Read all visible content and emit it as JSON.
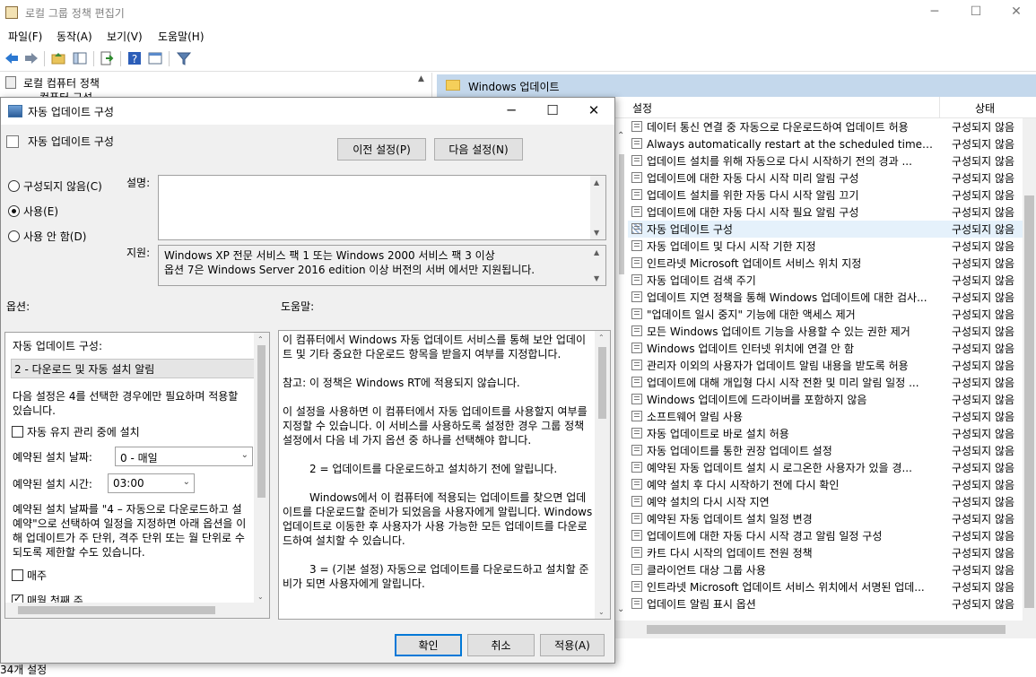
{
  "main_window": {
    "title": "로컬 그룹 정책 편집기",
    "menu": [
      "파일(F)",
      "동작(A)",
      "보기(V)",
      "도움말(H)"
    ],
    "tree_root": "로컬 컴퓨터 정책",
    "tree_child": "컴퓨터 구성",
    "right_header": "Windows 업데이트",
    "col_setting": "설정",
    "col_state": "상태",
    "status_bar": "34개 설정"
  },
  "policies": [
    {
      "name": "데이터 통신 연결 중 자동으로 다운로드하여 업데이트 허용",
      "state": "구성되지 않음"
    },
    {
      "name": "Always automatically restart at the scheduled time(항상 예...",
      "state": "구성되지 않음"
    },
    {
      "name": "업데이트 설치를 위해 자동으로 다시 시작하기 전의 경과 ...",
      "state": "구성되지 않음"
    },
    {
      "name": "업데이트에 대한 자동 다시 시작 미리 알림 구성",
      "state": "구성되지 않음"
    },
    {
      "name": "업데이트 설치를 위한 자동 다시 시작 알림 끄기",
      "state": "구성되지 않음"
    },
    {
      "name": "업데이트에 대한 자동 다시 시작 필요 알림 구성",
      "state": "구성되지 않음"
    },
    {
      "name": "자동 업데이트 구성",
      "state": "구성되지 않음"
    },
    {
      "name": "자동 업데이트 및 다시 시작 기한 지정",
      "state": "구성되지 않음"
    },
    {
      "name": "인트라넷 Microsoft 업데이트 서비스 위치 지정",
      "state": "구성되지 않음"
    },
    {
      "name": "자동 업데이트 검색 주기",
      "state": "구성되지 않음"
    },
    {
      "name": "업데이트 지연 정책을 통해 Windows 업데이트에 대한 검사...",
      "state": "구성되지 않음"
    },
    {
      "name": "\"업데이트 일시 중지\" 기능에 대한 액세스 제거",
      "state": "구성되지 않음"
    },
    {
      "name": "모든 Windows 업데이트 기능을 사용할 수 있는 권한 제거",
      "state": "구성되지 않음"
    },
    {
      "name": "Windows 업데이트 인터넷 위치에 연결 안 함",
      "state": "구성되지 않음"
    },
    {
      "name": "관리자 이외의 사용자가 업데이트 알림 내용을 받도록 허용",
      "state": "구성되지 않음"
    },
    {
      "name": "업데이트에 대해 개입형 다시 시작 전환 및 미리 알림 일정 ...",
      "state": "구성되지 않음"
    },
    {
      "name": "Windows 업데이트에 드라이버를 포함하지 않음",
      "state": "구성되지 않음"
    },
    {
      "name": "소프트웨어 알림 사용",
      "state": "구성되지 않음"
    },
    {
      "name": "자동 업데이트로 바로 설치 허용",
      "state": "구성되지 않음"
    },
    {
      "name": "자동 업데이트를 통한 권장 업데이트 설정",
      "state": "구성되지 않음"
    },
    {
      "name": "예약된 자동 업데이트 설치 시 로그온한 사용자가 있을 경...",
      "state": "구성되지 않음"
    },
    {
      "name": "예약 설치 후 다시 시작하기 전에 다시 확인",
      "state": "구성되지 않음"
    },
    {
      "name": "예약 설치의 다시 시작 지연",
      "state": "구성되지 않음"
    },
    {
      "name": "예약된 자동 업데이트 설치 일정 변경",
      "state": "구성되지 않음"
    },
    {
      "name": "업데이트에 대한 자동 다시 시작 경고 알림 일정 구성",
      "state": "구성되지 않음"
    },
    {
      "name": "카트 다시 시작의 업데이트 전원 정책",
      "state": "구성되지 않음"
    },
    {
      "name": "클라이언트 대상 그룹 사용",
      "state": "구성되지 않음"
    },
    {
      "name": "인트라넷 Microsoft 업데이트 서비스 위치에서 서명된 업데...",
      "state": "구성되지 않음"
    },
    {
      "name": "업데이트 알림 표시 옵션",
      "state": "구성되지 않음"
    }
  ],
  "dialog": {
    "title": "자동 업데이트 구성",
    "heading": "자동 업데이트 구성",
    "prev_button": "이전 설정(P)",
    "next_button": "다음 설정(N)",
    "radio_not_configured": "구성되지 않음(C)",
    "radio_enabled": "사용(E)",
    "radio_disabled": "사용 안 함(D)",
    "comment_label": "설명:",
    "supported_label": "지원:",
    "supported_line1": "Windows XP 전문 서비스 팩 1 또는 Windows 2000 서비스 팩 3 이상",
    "supported_line2": "옵션 7은 Windows Server 2016 edition 이상 버전의 서버 에서만 지원됩니다.",
    "options_label": "옵션:",
    "help_label": "도움말:",
    "ok_button": "확인",
    "cancel_button": "취소",
    "apply_button": "적용(A)"
  },
  "options": {
    "configure_label": "자동 업데이트 구성:",
    "configure_value": "2 - 다운로드 및 자동 설치 알림",
    "note": "다음 설정은 4를 선택한 경우에만 필요하며 적용할 수 있습니다.",
    "note_line1": "다음 설정은 4를 선택한 경우에만 필요하며 적용할",
    "note_line2": "있습니다.",
    "maintenance_check": "자동 유지 관리 중에 설치",
    "day_label": "예약된 설치 날짜:",
    "day_value": "0 - 매일",
    "time_label": "예약된 설치 시간:",
    "time_value": "03:00",
    "desc_line1": "예약된 설치 날짜를 \"4 – 자동으로 다운로드하고 설",
    "desc_line2": "예약\"으로 선택하여 일정을 지정하면 아래 옵션을 이",
    "desc_line3": "해 업데이트가 주 단위, 격주 단위 또는 월 단위로 수",
    "desc_line4": "되도록 제한할 수도 있습니다.",
    "weekly_check": "매주",
    "first_week_check": "매월 첫째 주"
  },
  "help": {
    "p1": "이 컴퓨터에서 Windows 자동 업데이트 서비스를 통해 보안 업데이트 및 기타 중요한 다운로드 항목을 받을지 여부를 지정합니다.",
    "p2": "참고: 이 정책은 Windows RT에 적용되지 않습니다.",
    "p3": "이 설정을 사용하면 이 컴퓨터에서 자동 업데이트를 사용할지 여부를 지정할 수 있습니다. 이 서비스를 사용하도록 설정한 경우 그룹 정책 설정에서 다음 네 가지 옵션 중 하나를 선택해야 합니다.",
    "p4": "2 = 업데이트를 다운로드하고 설치하기 전에 알립니다.",
    "p5": "Windows에서 이 컴퓨터에 적용되는 업데이트를 찾으면 업데이트를 다운로드할 준비가 되었음을 사용자에게 알립니다. Windows 업데이트로 이동한 후 사용자가 사용 가능한 모든 업데이트를 다운로드하여 설치할 수 있습니다.",
    "p6": "3 = (기본 설정) 자동으로 업데이트를 다운로드하고 설치할 준비가 되면 사용자에게 알립니다."
  }
}
